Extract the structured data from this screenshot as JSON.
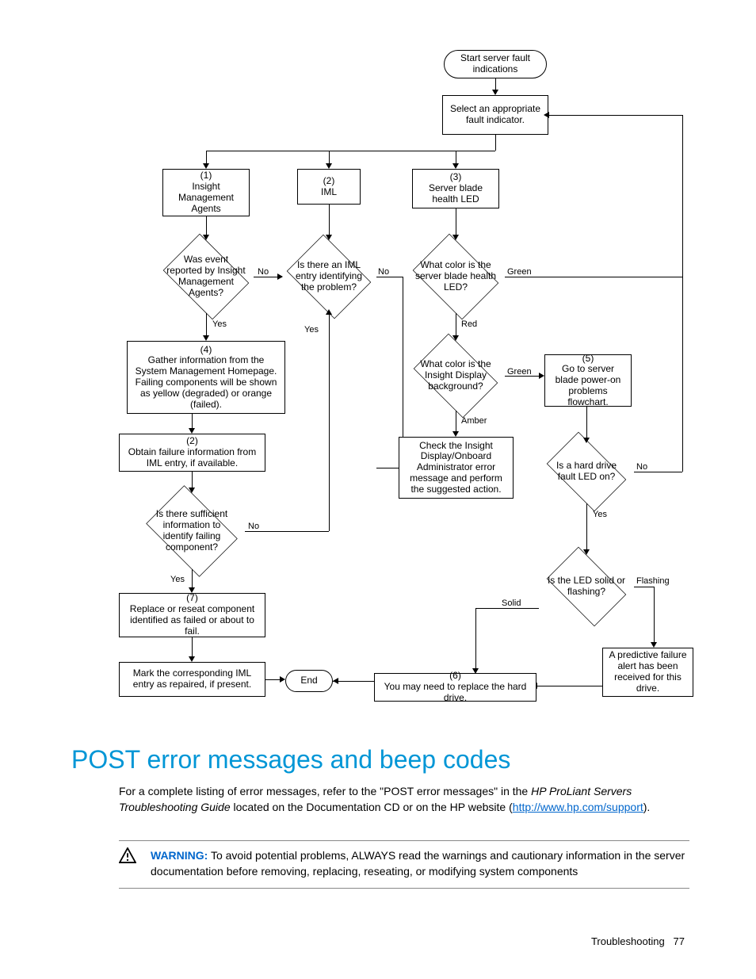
{
  "flowchart": {
    "start": "Start server fault indications",
    "select": "Select an appropriate fault indicator.",
    "b1": "(1)\nInsight Management Agents",
    "b2": "(2)\nIML",
    "b3": "(3)\nServer blade health LED",
    "d1": "Was event reported by Insight Management Agents?",
    "d2": "Is there an IML entry identifying the problem?",
    "d3": "What color is the server blade health LED?",
    "b4": "(4)\nGather information from the System Management Homepage. Failing components will be shown as yellow (degraded) or orange (failed).",
    "d4": "What color is the Insight Display background?",
    "b5": "(5)\nGo to server blade power-on problems flowchart.",
    "b2b": "(2)\nObtain failure information from IML entry, if available.",
    "bcheck": "Check the Insight Display/Onboard Administrator error message and perform the suggested action.",
    "d5": "Is there sufficient information to identify failing component?",
    "d6": "Is a hard drive fault LED on?",
    "d7": "Is the LED solid or flashing?",
    "b7": "(7)\nReplace or reseat component identified as failed or about to fail.",
    "bpred": "A predictive failure alert has been received for this drive.",
    "bmark": "Mark the corresponding IML entry as repaired, if present.",
    "b6": "(6)\nYou may need to replace the hard drive.",
    "end": "End",
    "labels": {
      "yes": "Yes",
      "no": "No",
      "red": "Red",
      "green": "Green",
      "amber": "Amber",
      "solid": "Solid",
      "flashing": "Flashing"
    }
  },
  "heading": "POST error messages and beep codes",
  "body": {
    "p1a": "For a complete listing of error messages, refer to the \"POST error messages\" in the ",
    "p1i": "HP ProLiant Servers Troubleshooting Guide",
    "p1b": " located on the Documentation CD or on the HP website (",
    "link": "http://www.hp.com/support",
    "p1c": ")."
  },
  "warning": {
    "label": "WARNING:",
    "text": "  To avoid potential problems, ALWAYS read the warnings and cautionary information in the server documentation before removing, replacing, reseating, or modifying system components"
  },
  "footer": {
    "section": "Troubleshooting",
    "page": "77"
  }
}
